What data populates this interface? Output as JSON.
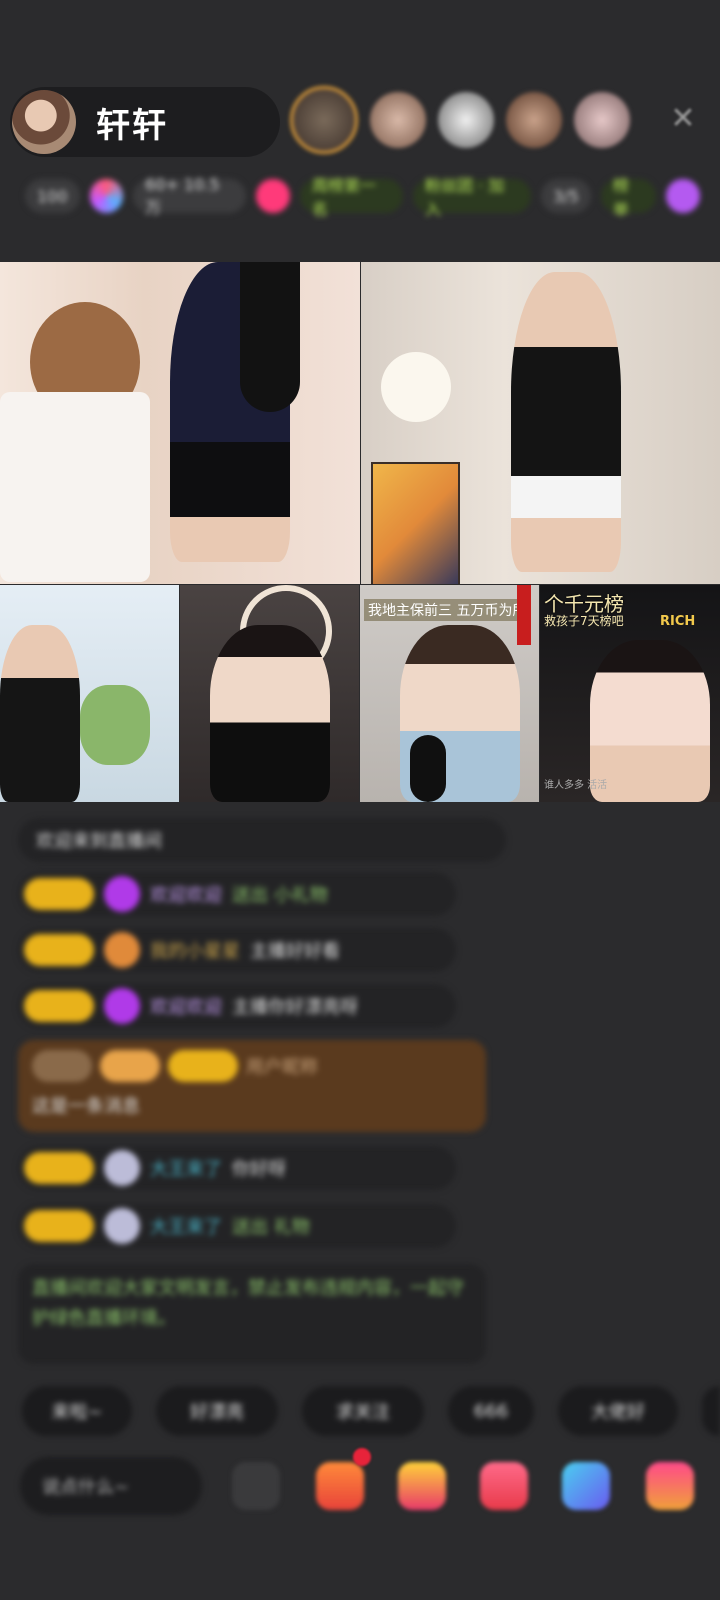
{
  "host": {
    "name": "轩轩"
  },
  "top": {
    "close_icon": "close-icon",
    "rank_bar": {
      "items": [
        "100",
        "60+ 10.5万",
        "周榜第一名",
        "粉丝团 · 加入",
        "3/5",
        "榜单"
      ]
    }
  },
  "videos": {
    "v5_caption": "我地主保前三   五万币为所",
    "v6_caption_top": "个千元榜",
    "v6_caption_sub": "救孩子7天榜吧",
    "v6_badge": "RICH",
    "v6_footer": "谁人多多 活活"
  },
  "chat": {
    "notice": "欢迎来到直播间",
    "messages": [
      {
        "user": "欢迎欢迎",
        "text": "送出 小礼物"
      },
      {
        "user": "我的小星星",
        "text": "主播好好看"
      },
      {
        "user": "欢迎欢迎",
        "text": "主播你好漂亮呀"
      },
      {
        "user": "用户昵称",
        "text": "这是一条消息"
      },
      {
        "user": "大王来了",
        "text": "你好呀"
      },
      {
        "user": "大王来了",
        "text": "送出 礼物"
      }
    ],
    "system_text": "直播间欢迎大家文明发言，禁止发布违规内容，一起守护绿色直播环境。"
  },
  "quick": [
    "来啦~",
    "好漂亮",
    "求关注",
    "666",
    "大佬好"
  ],
  "input": {
    "placeholder": "说点什么~"
  },
  "colors": {
    "badge": "#e8b21b",
    "accent_green": "#b6e35a",
    "background": "#2b2b2d"
  }
}
